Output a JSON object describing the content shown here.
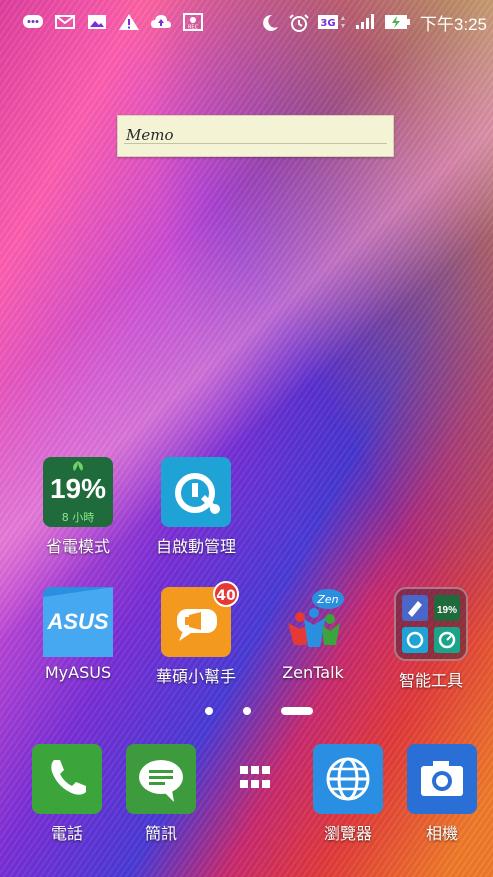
{
  "status_bar": {
    "time": "下午3:25",
    "network": "3G",
    "left_icons": [
      "chat-icon",
      "mail-icon",
      "image-icon",
      "warning-icon",
      "cloud-upload-icon",
      "record-icon"
    ],
    "right_icons": [
      "moon-icon",
      "alarm-icon",
      "3g-icon",
      "signal-icon",
      "battery-charging-icon"
    ]
  },
  "memo_widget": {
    "text": "Memo"
  },
  "apps": {
    "power_saver": {
      "label": "省電模式",
      "percent": "19%",
      "sub": "8 小時"
    },
    "auto_start": {
      "label": "自啟動管理"
    },
    "myasus": {
      "label": "MyASUS",
      "logo": "ASUS"
    },
    "helper": {
      "label": "華碩小幫手",
      "badge": "40"
    },
    "zentalk": {
      "label": "ZenTalk",
      "logo": "Zen"
    },
    "smart_tools": {
      "label": "智能工具",
      "mini_percent": "19%"
    }
  },
  "page_indicator": {
    "pages": 3,
    "active_index": 2
  },
  "dock": {
    "phone": {
      "label": "電話"
    },
    "messages": {
      "label": "簡訊"
    },
    "app_drawer": {
      "label": ""
    },
    "browser": {
      "label": "瀏覽器"
    },
    "camera": {
      "label": "相機"
    }
  },
  "colors": {
    "power_saver_bg": "#1f6b3b",
    "auto_start_bg": "#1fa3d6",
    "myasus_bg": "#2b8fe0",
    "helper_bg": "#f39a1e",
    "phone_bg": "#3ba53b",
    "messages_bg": "#3d9b3d",
    "browser_bg": "#2a8fe3",
    "camera_bg": "#2a6fd6"
  }
}
